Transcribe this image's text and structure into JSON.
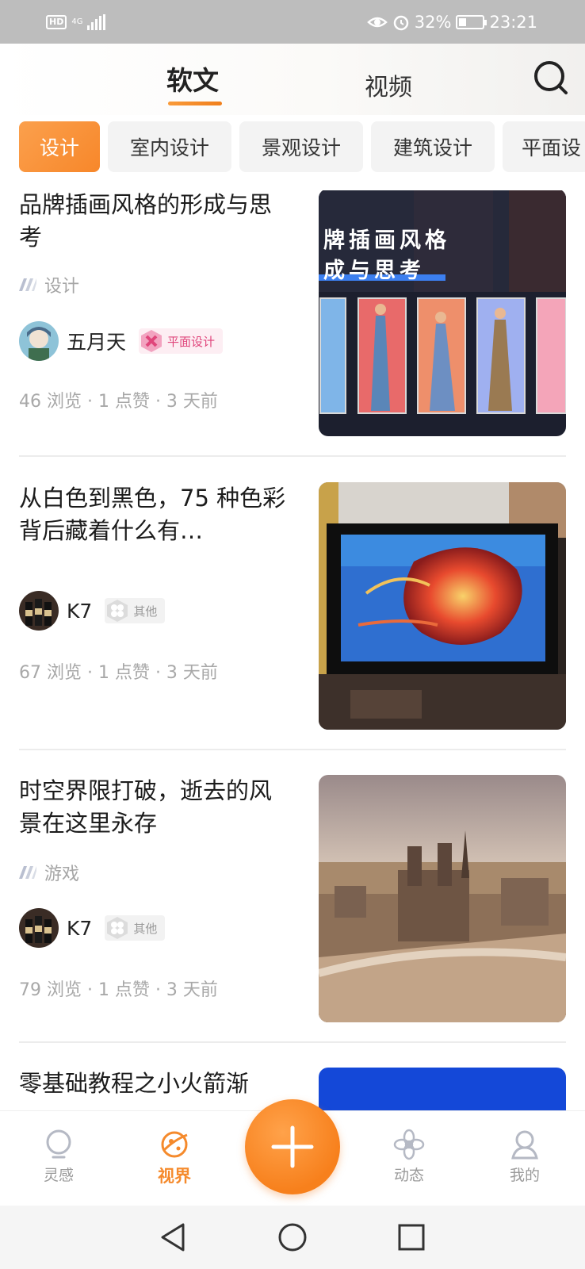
{
  "status_bar": {
    "hd": "HD",
    "network": "4G",
    "battery_text": "32%",
    "battery_level": 0.32,
    "time": "23:21",
    "icons": [
      "eye-icon",
      "alarm-icon",
      "battery-icon",
      "signal-icon"
    ]
  },
  "header": {
    "tabs": [
      {
        "label": "软文",
        "active": true
      },
      {
        "label": "视频",
        "active": false
      }
    ],
    "search_icon": "search-icon"
  },
  "categories": [
    {
      "label": "设计",
      "active": true
    },
    {
      "label": "室内设计",
      "active": false
    },
    {
      "label": "景观设计",
      "active": false
    },
    {
      "label": "建筑设计",
      "active": false
    },
    {
      "label": "平面设",
      "active": false
    }
  ],
  "articles": [
    {
      "title": "品牌插画风格的形成与思考",
      "category": "设计",
      "author": "五月天",
      "tag": "平面设计",
      "stats": "46 浏览 · 1 点赞 · 3 天前",
      "thumb_text_1": "牌插画风格",
      "thumb_text_2": "成与思考"
    },
    {
      "title": "从白色到黑色，75 种色彩背后藏着什么有…",
      "category": "",
      "author": "K7",
      "tag": "其他",
      "stats": "67 浏览 · 1 点赞 · 3 天前"
    },
    {
      "title": "时空界限打破，逝去的风景在这里永存",
      "category": "游戏",
      "author": "K7",
      "tag": "其他",
      "stats": "79 浏览 · 1 点赞 · 3 天前"
    },
    {
      "title": "零基础教程之小火箭渐"
    }
  ],
  "bottom_nav": [
    {
      "label": "灵感",
      "icon": "lightbulb-icon",
      "active": false
    },
    {
      "label": "视界",
      "icon": "planet-icon",
      "active": true
    },
    {
      "label": "动态",
      "icon": "flower-icon",
      "active": false
    },
    {
      "label": "我的",
      "icon": "user-icon",
      "active": false
    }
  ],
  "fab_icon": "plus-icon",
  "colors": {
    "accent": "#f7872a",
    "status_bar": "#bdbdbd",
    "text_gray": "#a8a8a8"
  }
}
